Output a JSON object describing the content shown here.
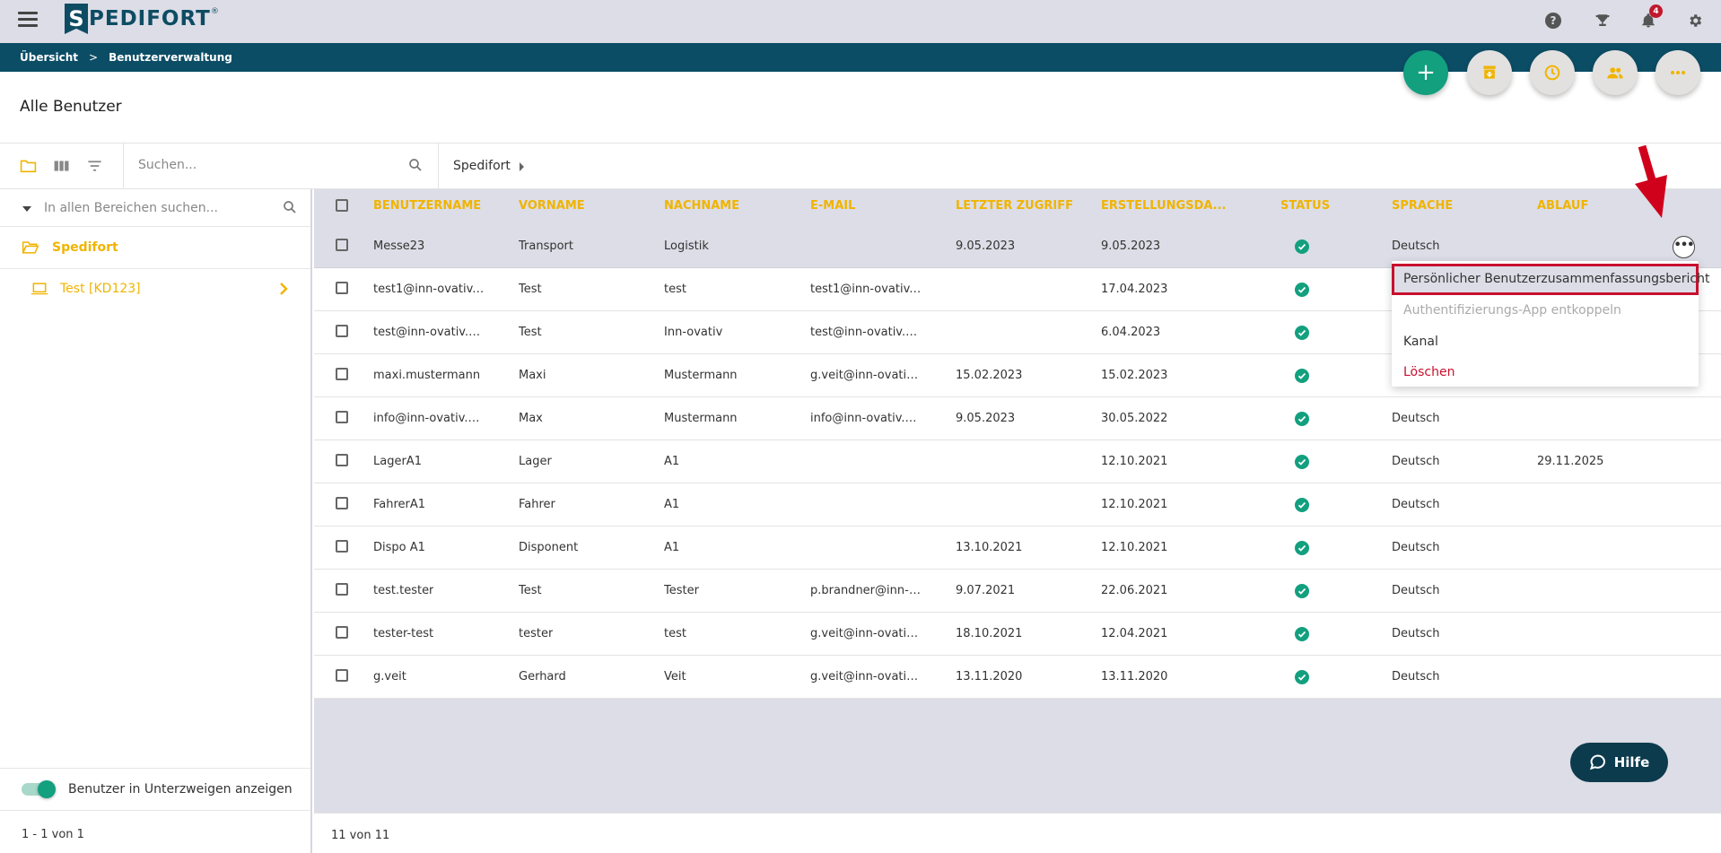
{
  "app": {
    "logo_letter": "S",
    "logo_text": "PEDIFORT",
    "logo_reg": "®"
  },
  "notifications": {
    "count": "4"
  },
  "breadcrumb": {
    "items": [
      "Übersicht",
      "Benutzerverwaltung"
    ],
    "separator": ">"
  },
  "fabs": {
    "add_symbol": "+"
  },
  "page": {
    "title": "Alle Benutzer"
  },
  "toolbar": {
    "search_placeholder": "Suchen...",
    "path": "Spedifort"
  },
  "left_panel": {
    "search_placeholder": "In allen Bereichen suchen...",
    "root_label": "Spedifort",
    "child_label": "Test [KD123]",
    "toggle_label": "Benutzer in Unterzweigen anzeigen",
    "toggle_on": true,
    "footer": "1 - 1 von 1"
  },
  "table": {
    "headers": {
      "username": "BENUTZERNAME",
      "firstname": "VORNAME",
      "lastname": "NACHNAME",
      "email": "E-MAIL",
      "last_access": "LETZTER ZUGRIFF",
      "created": "ERSTELLUNGSDA...",
      "status": "STATUS",
      "language": "SPRACHE",
      "expiry": "ABLAUF"
    },
    "rows": [
      {
        "username": "Messe23",
        "firstname": "Transport",
        "lastname": "Logistik",
        "email": "",
        "last_access": "9.05.2023",
        "created": "9.05.2023",
        "language": "Deutsch",
        "expiry": ""
      },
      {
        "username": "test1@inn-ovativ.co...",
        "firstname": "Test",
        "lastname": "test",
        "email": "test1@inn-ovativ.co...",
        "last_access": "",
        "created": "17.04.2023",
        "language": "",
        "expiry": ""
      },
      {
        "username": "test@inn-ovativ.com",
        "firstname": "Test",
        "lastname": "Inn-ovativ",
        "email": "test@inn-ovativ.com",
        "last_access": "",
        "created": "6.04.2023",
        "language": "",
        "expiry": ""
      },
      {
        "username": "maxi.mustermann",
        "firstname": "Maxi",
        "lastname": "Mustermann",
        "email": "g.veit@inn-ovativ.c...",
        "last_access": "15.02.2023",
        "created": "15.02.2023",
        "language": "",
        "expiry": ""
      },
      {
        "username": "info@inn-ovativ.com",
        "firstname": "Max",
        "lastname": "Mustermann",
        "email": "info@inn-ovativ.com",
        "last_access": "9.05.2023",
        "created": "30.05.2022",
        "language": "Deutsch",
        "expiry": ""
      },
      {
        "username": "LagerA1",
        "firstname": "Lager",
        "lastname": "A1",
        "email": "",
        "last_access": "",
        "created": "12.10.2021",
        "language": "Deutsch",
        "expiry": "29.11.2025"
      },
      {
        "username": "FahrerA1",
        "firstname": "Fahrer",
        "lastname": "A1",
        "email": "",
        "last_access": "",
        "created": "12.10.2021",
        "language": "Deutsch",
        "expiry": ""
      },
      {
        "username": "Dispo A1",
        "firstname": "Disponent",
        "lastname": "A1",
        "email": "",
        "last_access": "13.10.2021",
        "created": "12.10.2021",
        "language": "Deutsch",
        "expiry": ""
      },
      {
        "username": "test.tester",
        "firstname": "Test",
        "lastname": "Tester",
        "email": "p.brandner@inn-ov...",
        "last_access": "9.07.2021",
        "created": "22.06.2021",
        "language": "Deutsch",
        "expiry": ""
      },
      {
        "username": "tester-test",
        "firstname": "tester",
        "lastname": "test",
        "email": "g.veit@inn-ovativ.c...",
        "last_access": "18.10.2021",
        "created": "12.04.2021",
        "language": "Deutsch",
        "expiry": ""
      },
      {
        "username": "g.veit",
        "firstname": "Gerhard",
        "lastname": "Veit",
        "email": "g.veit@inn-ovativ.c...",
        "last_access": "13.11.2020",
        "created": "13.11.2020",
        "language": "Deutsch",
        "expiry": ""
      }
    ],
    "more_button": "•••"
  },
  "context_menu": {
    "items": [
      {
        "label": "Persönlicher Benutzerzusammenfassungsbericht"
      },
      {
        "label": "Authentifizierungs-App entkoppeln"
      },
      {
        "label": "Kanal"
      },
      {
        "label": "Löschen"
      }
    ]
  },
  "pagination": {
    "text": "11 von 11"
  },
  "help_button": {
    "label": "Hilfe"
  },
  "colors": {
    "accent": "#f0b400",
    "primary": "#0c4d66",
    "success": "#12a07f",
    "danger": "#c8102e"
  },
  "icons": [
    "menu-icon",
    "question-icon",
    "trophy-icon",
    "bell-icon",
    "gear-icon",
    "plus-icon",
    "archive-icon",
    "clock-icon",
    "users-icon",
    "more-icon",
    "folder-icon",
    "columns-icon",
    "filter-icon",
    "search-icon",
    "caret-right-icon",
    "caret-down-icon",
    "folder-open-icon",
    "laptop-icon",
    "chevron-right-icon",
    "check-icon",
    "chat-icon",
    "arrow-down-icon"
  ]
}
